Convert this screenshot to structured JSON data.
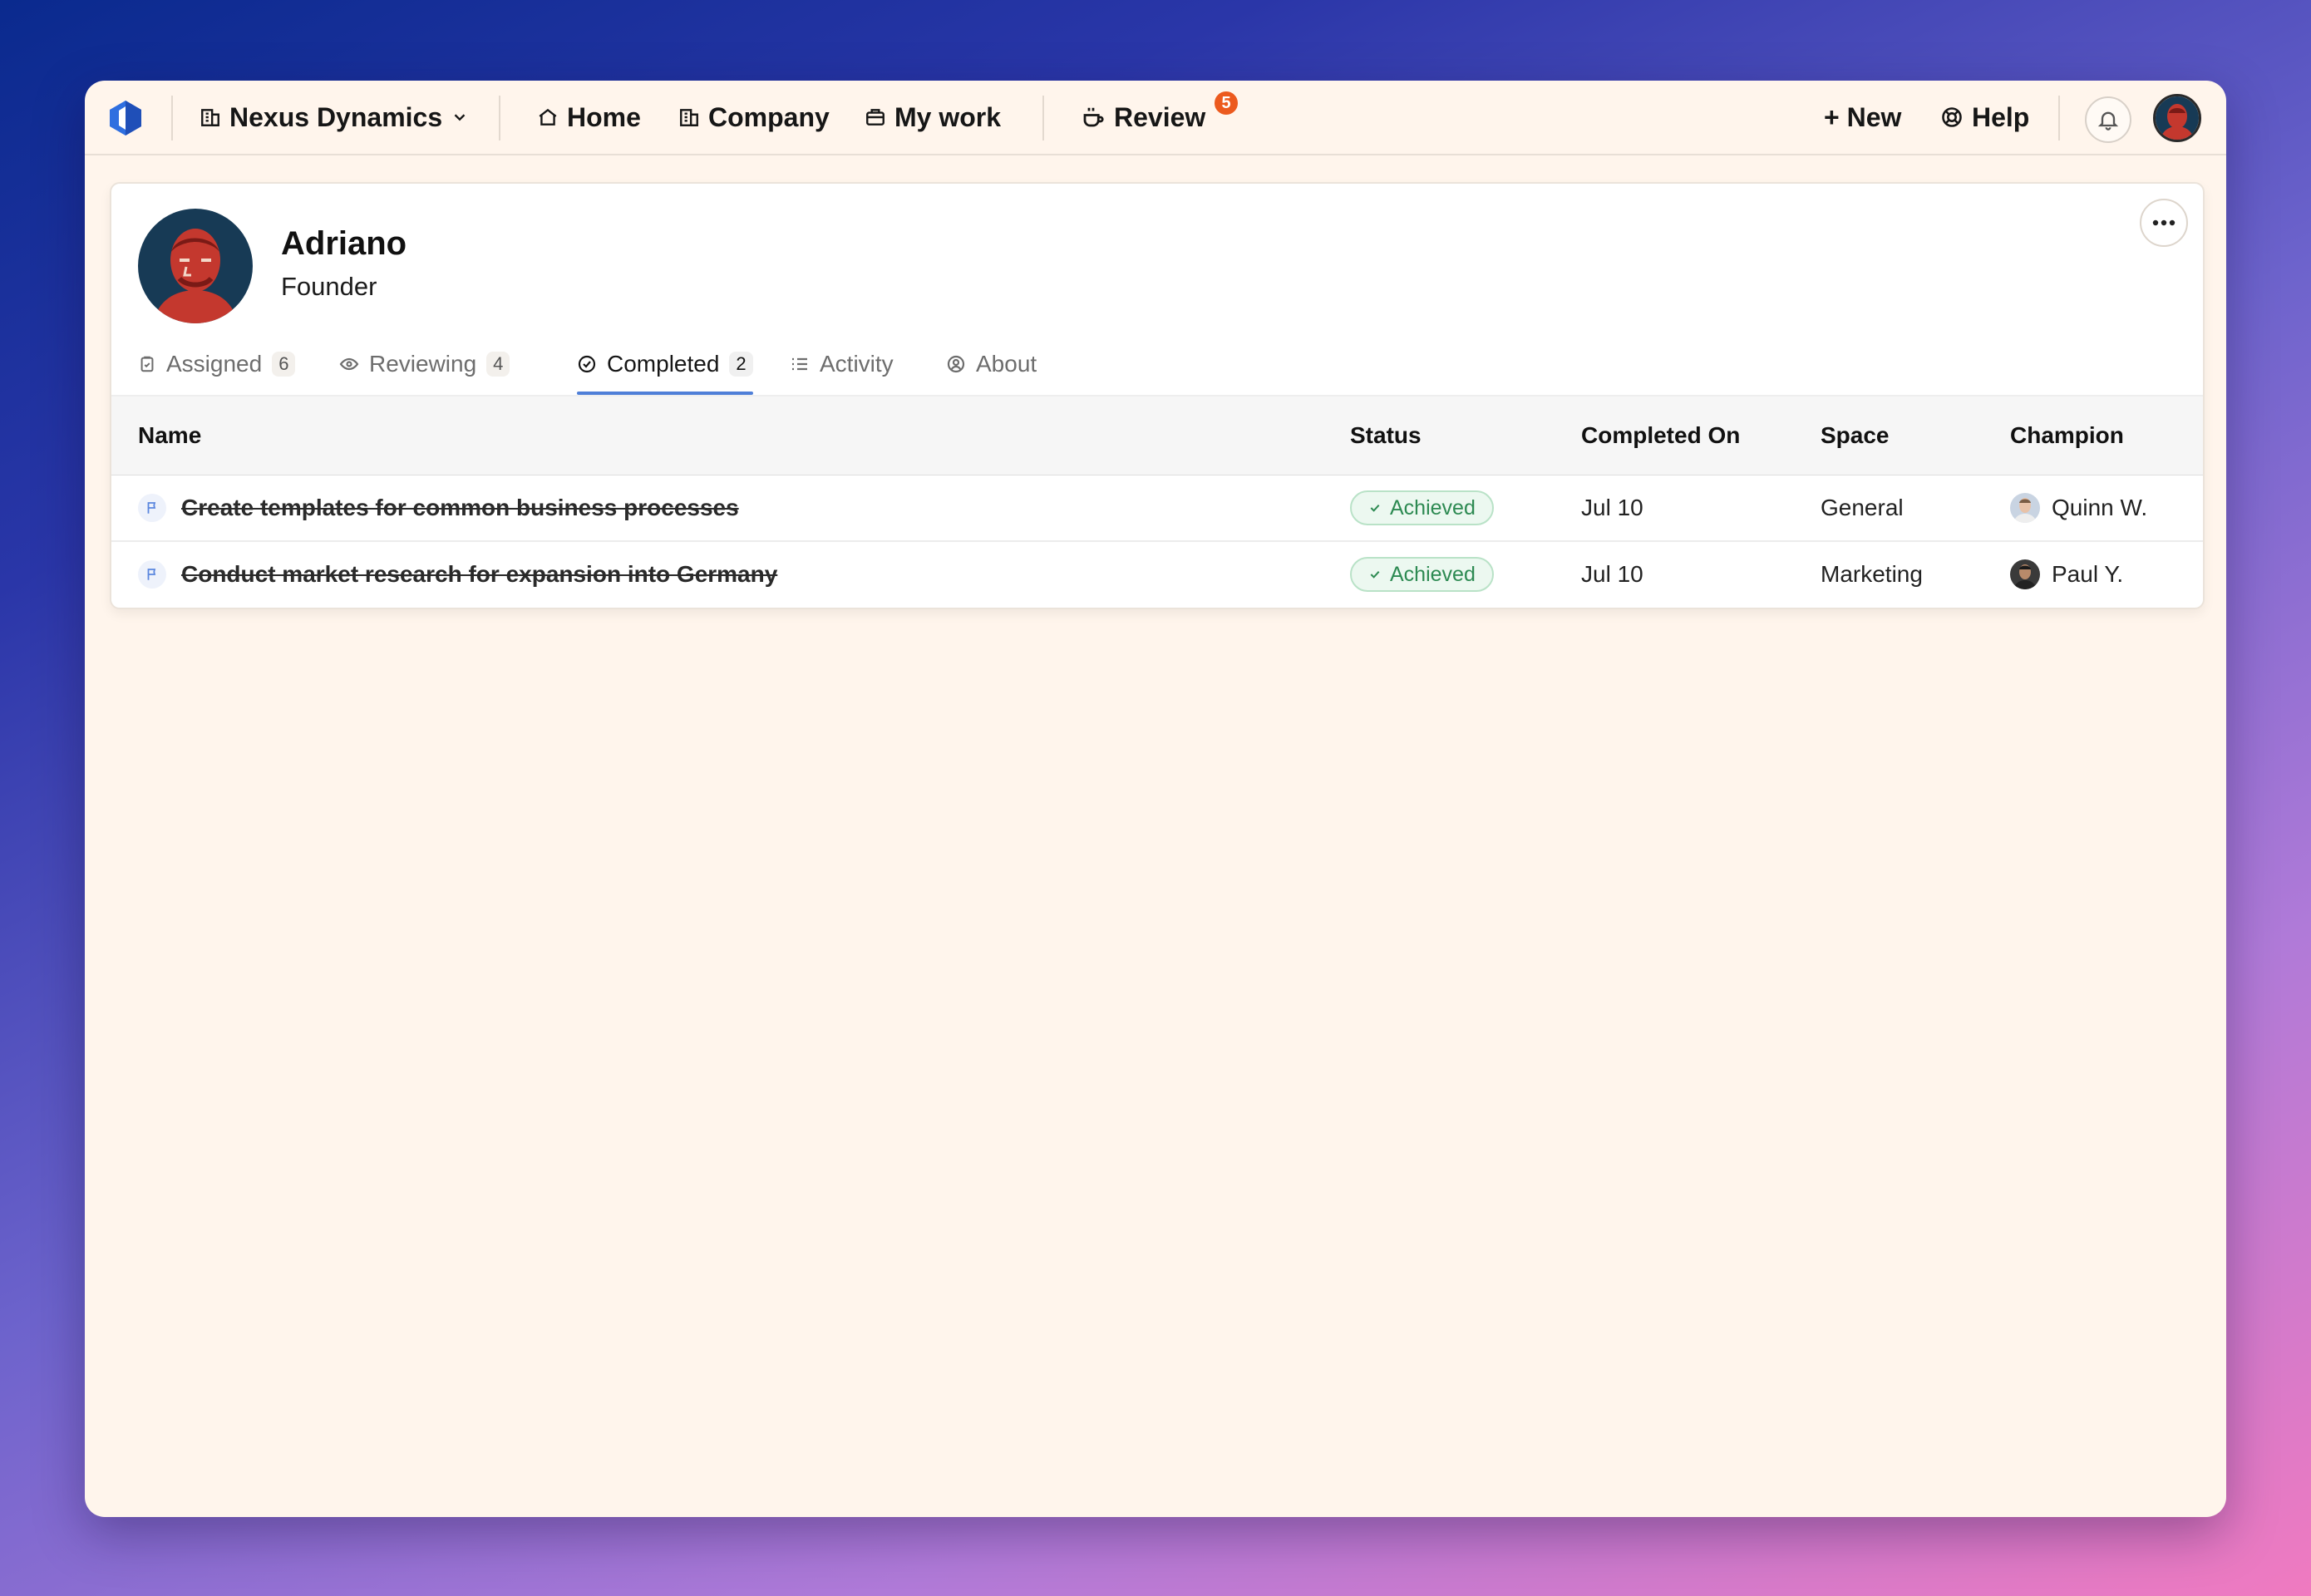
{
  "nav": {
    "workspace": "Nexus Dynamics",
    "home": "Home",
    "company": "Company",
    "my_work": "My work",
    "review": "Review",
    "review_badge": "5",
    "new": "+ New",
    "help": "Help"
  },
  "profile": {
    "name": "Adriano",
    "title": "Founder"
  },
  "tabs": [
    {
      "label": "Assigned",
      "count": "6",
      "icon": "clipboard-icon"
    },
    {
      "label": "Reviewing",
      "count": "4",
      "icon": "eye-icon"
    },
    {
      "label": "Completed",
      "count": "2",
      "icon": "check-circle-icon",
      "active": true
    },
    {
      "label": "Activity",
      "icon": "list-icon"
    },
    {
      "label": "About",
      "icon": "user-circle-icon"
    }
  ],
  "table": {
    "headers": {
      "name": "Name",
      "status": "Status",
      "completed_on": "Completed On",
      "space": "Space",
      "champion": "Champion"
    },
    "rows": [
      {
        "name": "Create templates for common business processes",
        "status": "Achieved",
        "completed_on": "Jul 10",
        "space": "General",
        "champion": "Quinn W."
      },
      {
        "name": "Conduct market research for expansion into Germany",
        "status": "Achieved",
        "completed_on": "Jul 10",
        "space": "Marketing",
        "champion": "Paul Y."
      }
    ]
  },
  "colors": {
    "accent": "#4f7fd8",
    "badge": "#ec5a1e",
    "success": "#2d8a52",
    "window_bg": "#fff5ec"
  }
}
